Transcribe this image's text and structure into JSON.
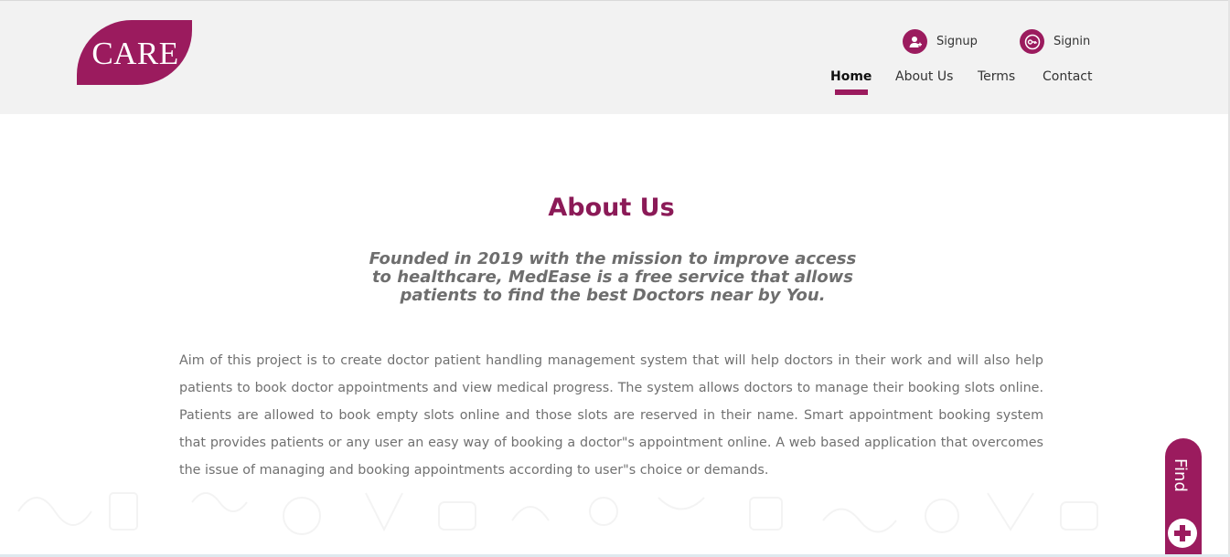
{
  "logo": {
    "text": "CARE"
  },
  "auth": {
    "signup": "Signup",
    "signin": "Signin"
  },
  "nav": {
    "home": "Home",
    "about": "About Us",
    "terms": "Terms",
    "contact": "Contact"
  },
  "main": {
    "title": "About Us",
    "subtitle": "Founded in 2019 with the mission to improve access to healthcare, MedEase is a free service that allows patients to find the best Doctors near by You.",
    "body": "Aim of this project is to create doctor patient handling management system that will help doctors in their work and will also help patients to book doctor appointments and view medical progress. The system allows doctors to manage their booking slots online. Patients are allowed to book empty slots online and those slots are reserved in their name. Smart appointment booking system that provides patients or any user an easy way of booking a doctor\"s appointment online. A web based application that overcomes the issue of managing and booking appointments according to user\"s choice or demands."
  },
  "find_tab": {
    "label": "Find"
  },
  "colors": {
    "brand": "#9b1b5e",
    "title": "#8b1a57",
    "header_bg": "#f2f2f2"
  },
  "icons": {
    "signup": "user-add-icon",
    "signin": "key-icon",
    "find": "plus-icon"
  }
}
